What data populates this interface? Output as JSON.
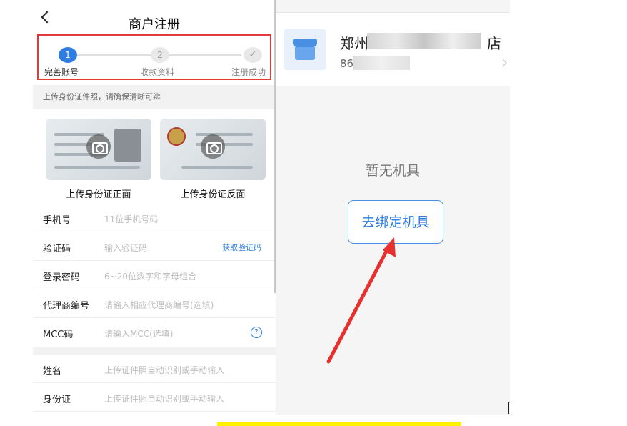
{
  "left_app": {
    "title": "商户注册",
    "steps": [
      {
        "number": "1",
        "label": "完善账号",
        "state": "active"
      },
      {
        "number": "2",
        "label": "收款资料",
        "state": "pending"
      },
      {
        "number": "✓",
        "label": "注册成功",
        "state": "pending"
      }
    ],
    "tip": "上传身份证件照，请确保清晰可辨",
    "id_front_label": "上传身份证正面",
    "id_back_label": "上传身份证反面",
    "fields": [
      {
        "label": "手机号",
        "placeholder": "11位手机号码"
      },
      {
        "label": "验证码",
        "placeholder": "输入验证码",
        "action": "获取验证码"
      },
      {
        "label": "登录密码",
        "placeholder": "6~20位数字和字母组合"
      },
      {
        "label": "代理商编号",
        "placeholder": "请输入相应代理商编号(选填)"
      },
      {
        "label": "MCC码",
        "placeholder": "请输入MCC(选填)",
        "help": "?"
      }
    ],
    "fields2": [
      {
        "label": "姓名",
        "placeholder": "上传证件照自动识别或手动输入"
      },
      {
        "label": "身份证",
        "placeholder": "上传证件照自动识别或手动输入"
      }
    ]
  },
  "right_app": {
    "store_name": "郑州",
    "store_name_tail": "店",
    "store_phone_prefix": "86",
    "empty_text": "暂无机具",
    "bind_button": "去绑定机具"
  },
  "colors": {
    "accent": "#2f7de0",
    "highlight_box": "#e23a3a",
    "arrow": "#e8312d",
    "underline": "#fff200"
  }
}
